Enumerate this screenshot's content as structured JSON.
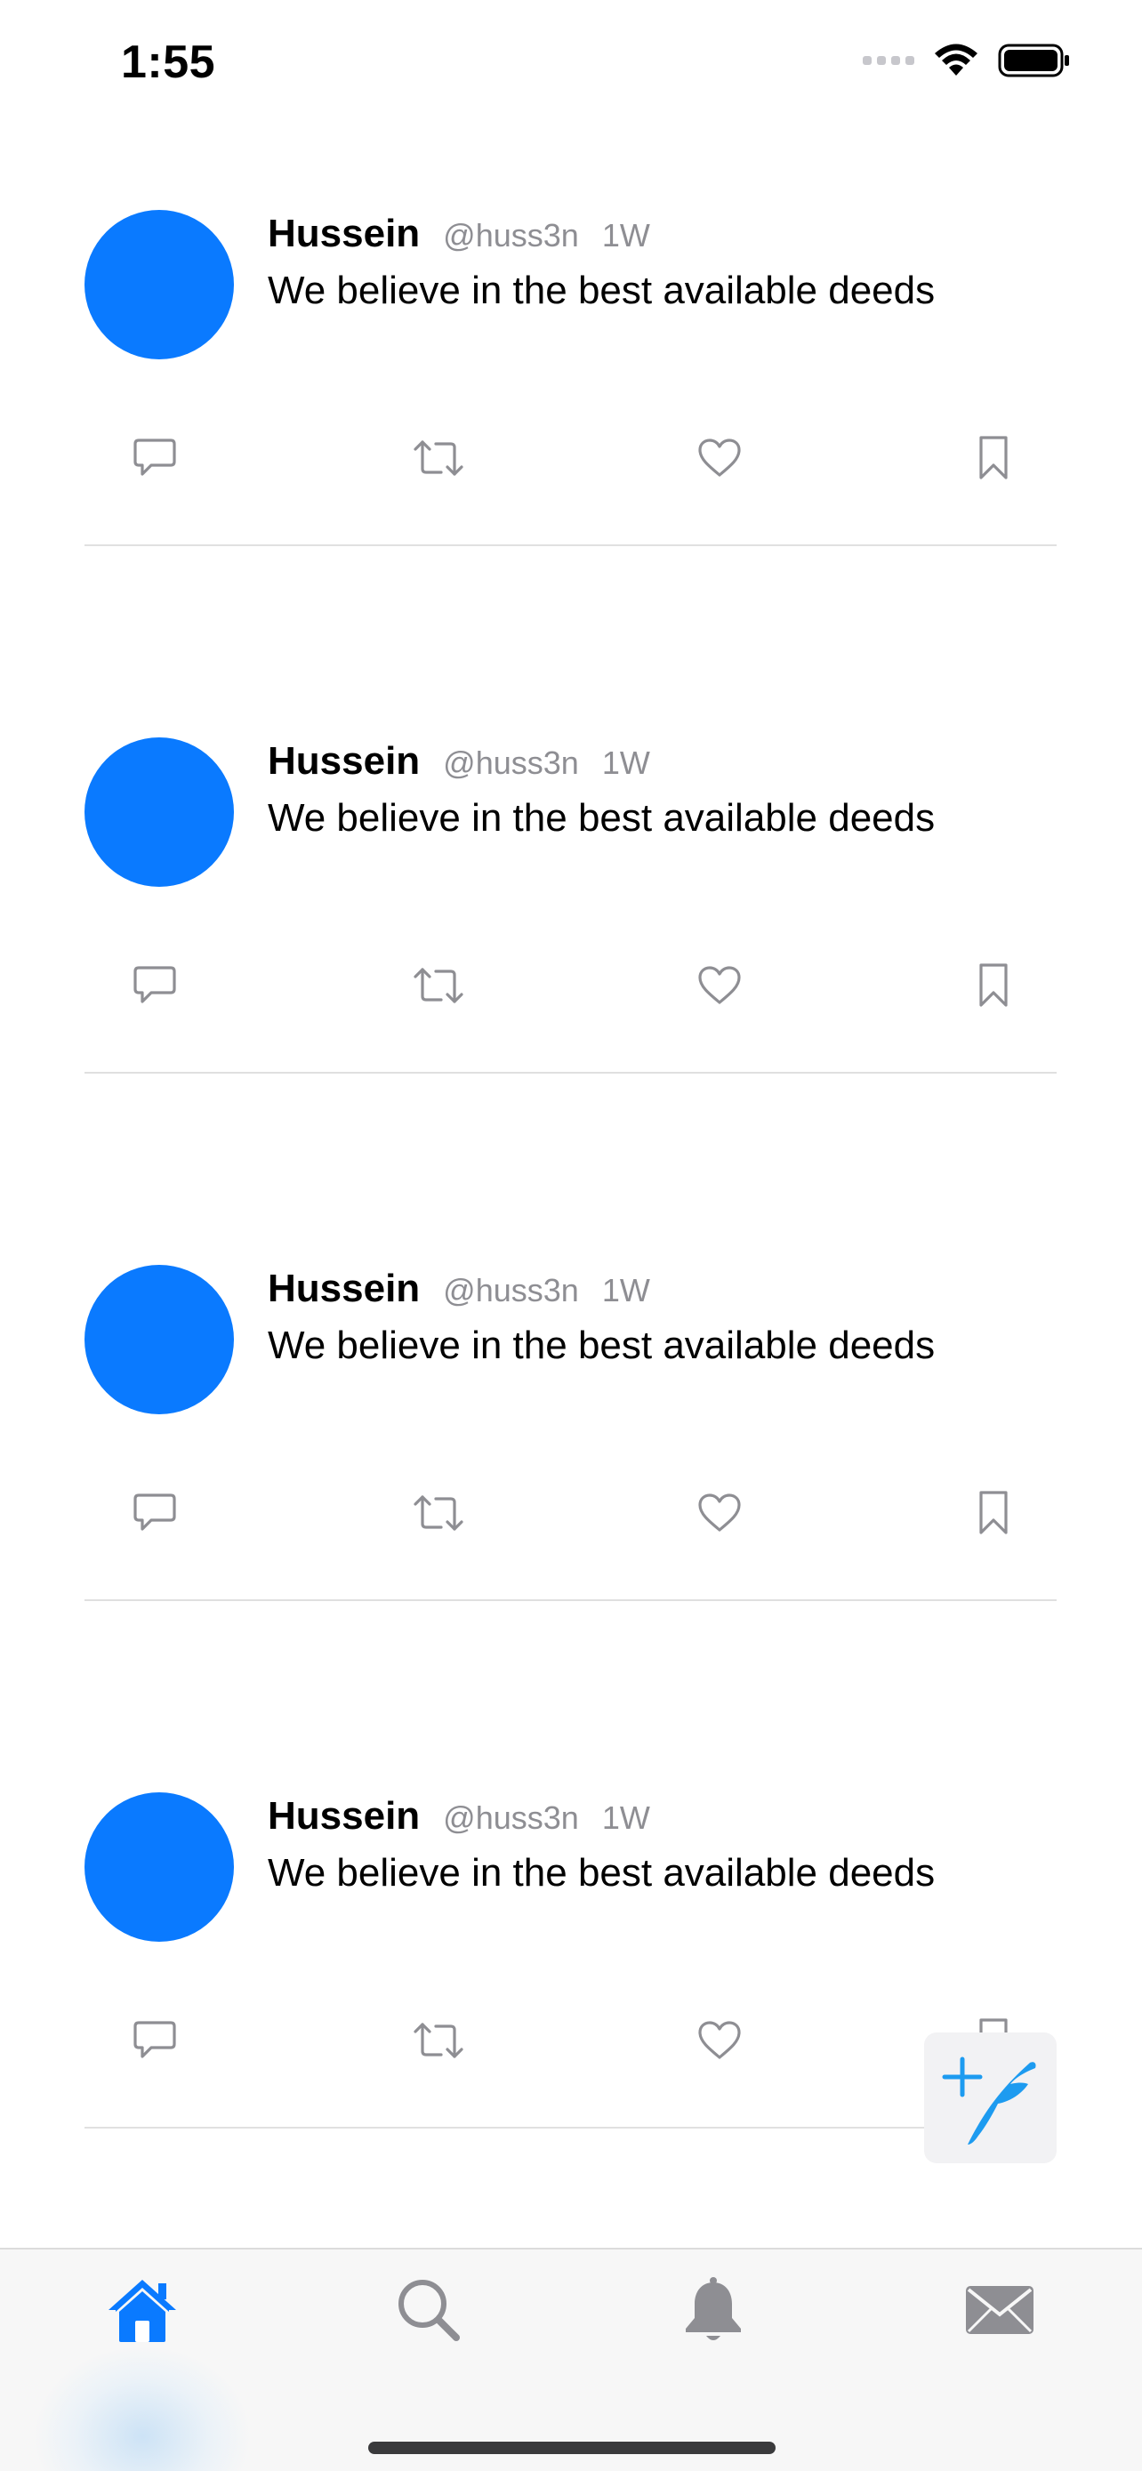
{
  "status_bar": {
    "time": "1:55"
  },
  "feed": {
    "tweets": [
      {
        "name": "Hussein",
        "handle": "@huss3n",
        "time": "1W",
        "text": "We believe in the best available deeds"
      },
      {
        "name": "Hussein",
        "handle": "@huss3n",
        "time": "1W",
        "text": "We believe in the best available deeds"
      },
      {
        "name": "Hussein",
        "handle": "@huss3n",
        "time": "1W",
        "text": "We believe in the best available deeds"
      },
      {
        "name": "Hussein",
        "handle": "@huss3n",
        "time": "1W",
        "text": "We believe in the best available deeds"
      }
    ],
    "actions": [
      "reply-icon",
      "retweet-icon",
      "like-icon",
      "bookmark-icon"
    ]
  },
  "compose": {
    "icon": "compose-quill-icon"
  },
  "tab_bar": {
    "tabs": [
      "home-icon",
      "search-icon",
      "bell-icon",
      "mail-icon"
    ],
    "selected": "home-icon"
  },
  "colors": {
    "accent": "#0a7aff",
    "compose_blue": "#1d9bf0",
    "secondary_text": "#8e8e93",
    "icon_gray": "#8e8e93",
    "divider": "#e0e0e0",
    "tab_bar_bg": "#f7f7f7"
  }
}
